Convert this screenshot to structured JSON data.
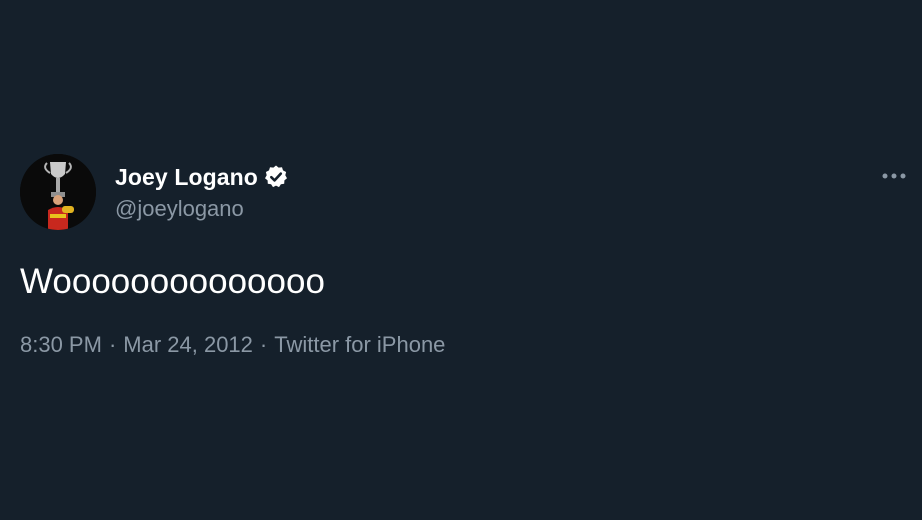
{
  "tweet": {
    "author": {
      "display_name": "Joey Logano",
      "handle": "@joeylogano",
      "verified": true,
      "verified_icon": "verified-badge-icon",
      "avatar": "avatar-trophy-photo"
    },
    "text": "Woooooooooooooo",
    "time": "8:30 PM",
    "separator": "·",
    "date": "Mar 24, 2012",
    "source": "Twitter for iPhone",
    "more_icon": "more-options-icon"
  },
  "colors": {
    "background": "#15202b",
    "primary_text": "#ffffff",
    "secondary_text": "#8b98a5"
  }
}
